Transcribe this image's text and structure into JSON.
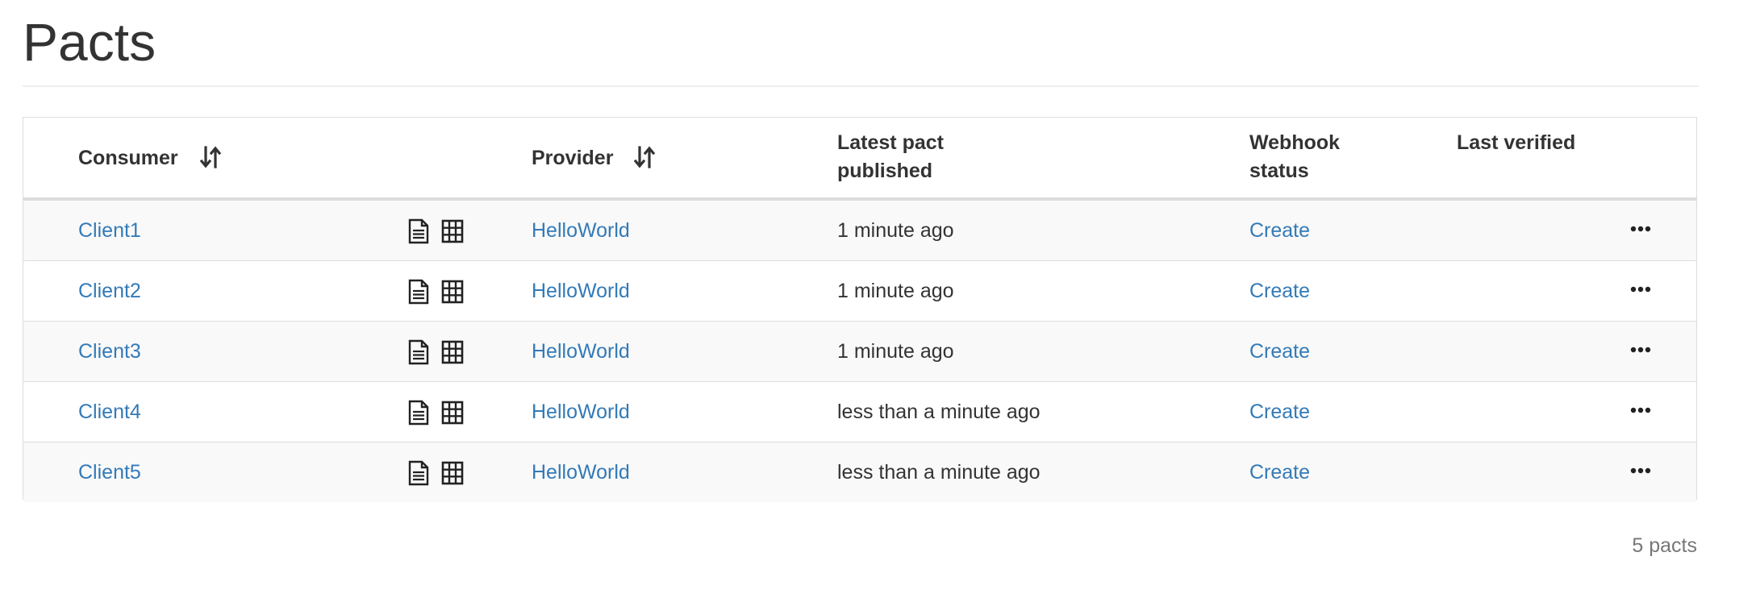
{
  "page": {
    "title": "Pacts"
  },
  "table": {
    "headers": {
      "consumer": "Consumer",
      "provider": "Provider",
      "latest_pact_published": "Latest pact published",
      "webhook_status": "Webhook status",
      "last_verified": "Last verified"
    },
    "rows": [
      {
        "consumer": "Client1",
        "provider": "HelloWorld",
        "published": "1 minute ago",
        "webhook": "Create",
        "last_verified": ""
      },
      {
        "consumer": "Client2",
        "provider": "HelloWorld",
        "published": "1 minute ago",
        "webhook": "Create",
        "last_verified": ""
      },
      {
        "consumer": "Client3",
        "provider": "HelloWorld",
        "published": "1 minute ago",
        "webhook": "Create",
        "last_verified": ""
      },
      {
        "consumer": "Client4",
        "provider": "HelloWorld",
        "published": "less than a minute ago",
        "webhook": "Create",
        "last_verified": ""
      },
      {
        "consumer": "Client5",
        "provider": "HelloWorld",
        "published": "less than a minute ago",
        "webhook": "Create",
        "last_verified": ""
      }
    ],
    "row_icons": [
      "document-icon",
      "matrix-grid-icon",
      "more-options-icon"
    ],
    "sort_icon": "sort-arrows-icon"
  },
  "footer": {
    "count_text": "5 pacts"
  },
  "colors": {
    "link": "#337ab7",
    "text": "#333333",
    "muted": "#777777",
    "stripe": "#f9f9f9",
    "border": "#dddddd"
  }
}
